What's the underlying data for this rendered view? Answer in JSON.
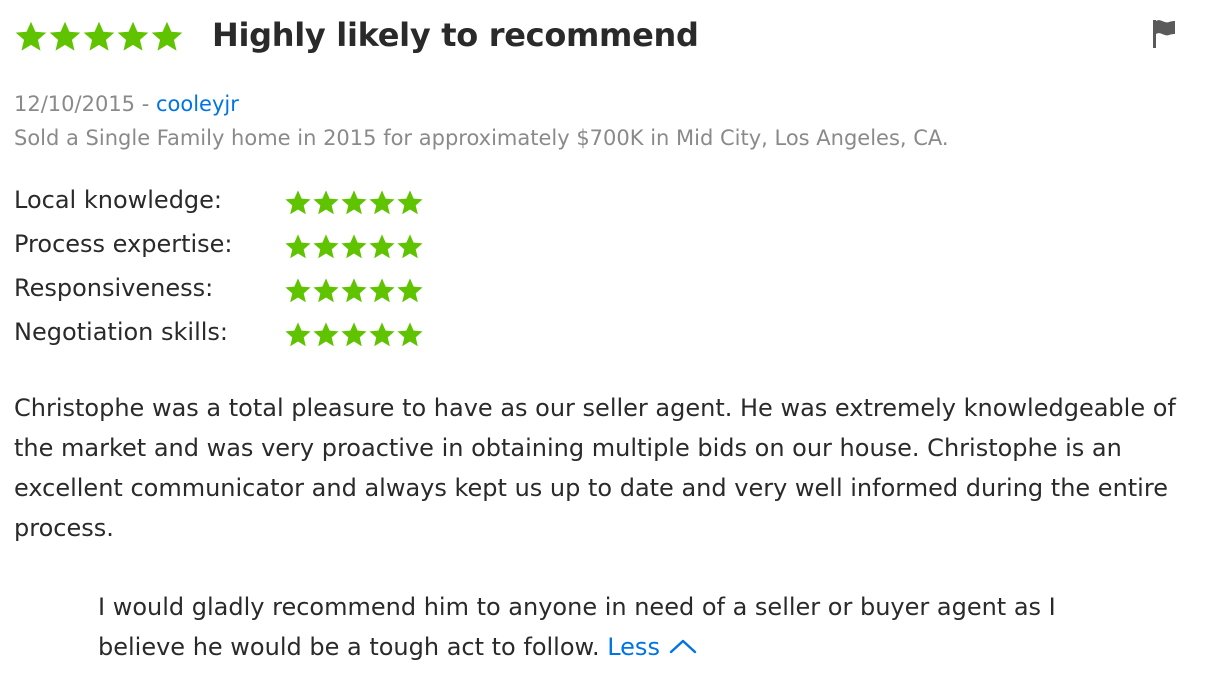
{
  "review": {
    "overall_rating": 5,
    "rating_max": 5,
    "headline": "Highly likely to recommend",
    "flag_icon": "flag-icon",
    "date": "12/10/2015",
    "separator": " - ",
    "author": "cooleyjr",
    "transaction": "Sold a Single Family home in 2015 for approximately $700K in Mid City, Los Angeles, CA.",
    "ratings": [
      {
        "label": "Local knowledge:",
        "value": 5
      },
      {
        "label": "Process expertise:",
        "value": 5
      },
      {
        "label": "Responsiveness:",
        "value": 5
      },
      {
        "label": "Negotiation skills:",
        "value": 5
      }
    ],
    "body": "Christophe was a total pleasure to have as our seller agent. He was extremely knowledgeable of the market and was very proactive in obtaining multiple bids on our house. Christophe is an excellent communicator and always kept us up to date and very well informed during the entire process.",
    "body_indented": "I would gladly recommend him to anyone in need of a seller or buyer agent as I believe he would be a tough act to follow.",
    "less_label": "Less",
    "less_icon": "chevron-up-icon"
  },
  "colors": {
    "star_green": "#5fc300",
    "link_blue": "#0074e4",
    "muted_gray": "#8a8a8a",
    "text_dark": "#2a2a2a"
  }
}
